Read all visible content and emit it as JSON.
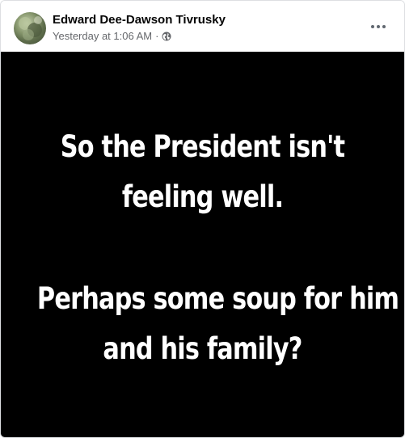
{
  "post": {
    "author": "Edward Dee-Dawson Tivrusky",
    "timestamp": "Yesterday at 1:06 AM",
    "separator": "·",
    "audience_icon": "globe-icon",
    "more_icon": "more-options-icon"
  },
  "image": {
    "background_color": "#000000",
    "text_color": "#ffffff",
    "lines": [
      "So the President isn't",
      "feeling well.",
      "Perhaps some soup for him",
      "and his family?"
    ]
  }
}
